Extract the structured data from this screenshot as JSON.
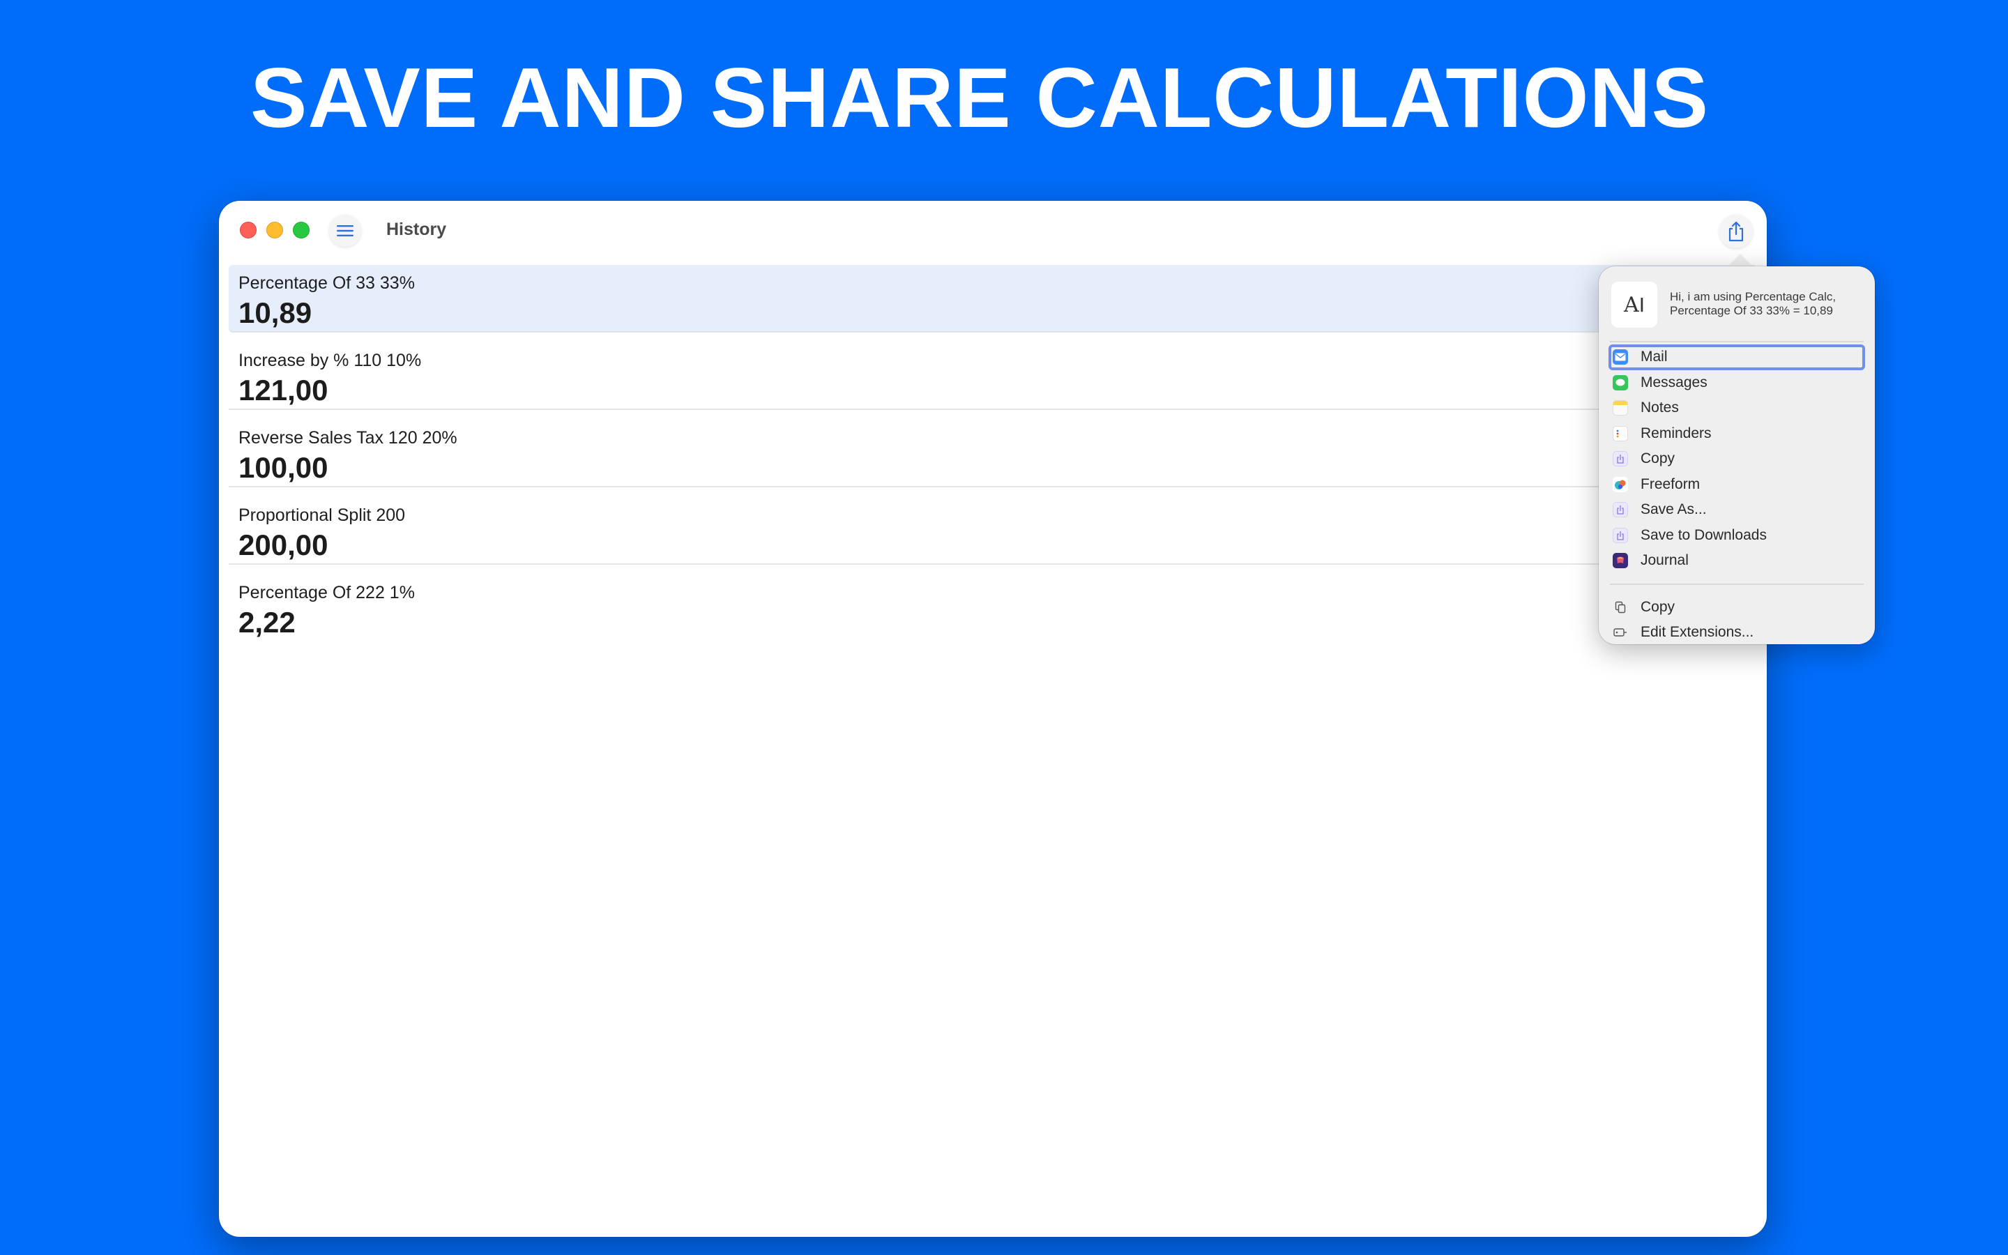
{
  "headline": "SAVE AND SHARE CALCULATIONS",
  "window": {
    "title": "History"
  },
  "history": [
    {
      "label": "Percentage Of 33 33%",
      "value": "10,89",
      "selected": true
    },
    {
      "label": "Increase by % 110 10%",
      "value": "121,00",
      "selected": false
    },
    {
      "label": "Reverse Sales Tax 120 20%",
      "value": "100,00",
      "selected": false
    },
    {
      "label": "Proportional Split 200",
      "value": "200,00",
      "selected": false
    },
    {
      "label": "Percentage Of 222 1%",
      "value": "2,22",
      "selected": false
    }
  ],
  "share_popover": {
    "preview_line1": "Hi, i am using Percentage Calc,",
    "preview_line2": "Percentage Of 33 33% = 10,89",
    "items": [
      {
        "label": "Mail",
        "icon": "mail-icon",
        "color": "#3d8df5"
      },
      {
        "label": "Messages",
        "icon": "messages-icon",
        "color": "#34c759"
      },
      {
        "label": "Notes",
        "icon": "notes-icon",
        "color": "#ffd54a"
      },
      {
        "label": "Reminders",
        "icon": "reminders-icon",
        "color": "#ffffff"
      },
      {
        "label": "Copy",
        "icon": "share-copy-icon",
        "color": "#b9a8f0"
      },
      {
        "label": "Freeform",
        "icon": "freeform-icon",
        "color": "#2fb8c9"
      },
      {
        "label": "Save As...",
        "icon": "save-as-icon",
        "color": "#b9a8f0"
      },
      {
        "label": "Save to Downloads",
        "icon": "save-downloads-icon",
        "color": "#b9a8f0"
      },
      {
        "label": "Journal",
        "icon": "journal-icon",
        "color": "#3b2a7a"
      }
    ],
    "footer_items": [
      {
        "label": "Copy",
        "icon": "copy-icon"
      },
      {
        "label": "Edit Extensions...",
        "icon": "extensions-icon"
      }
    ]
  },
  "colors": {
    "background": "#006dfa",
    "selected_row": "#e6eefb",
    "focus_ring": "#6f8fe8",
    "accent": "#2f6fde"
  }
}
